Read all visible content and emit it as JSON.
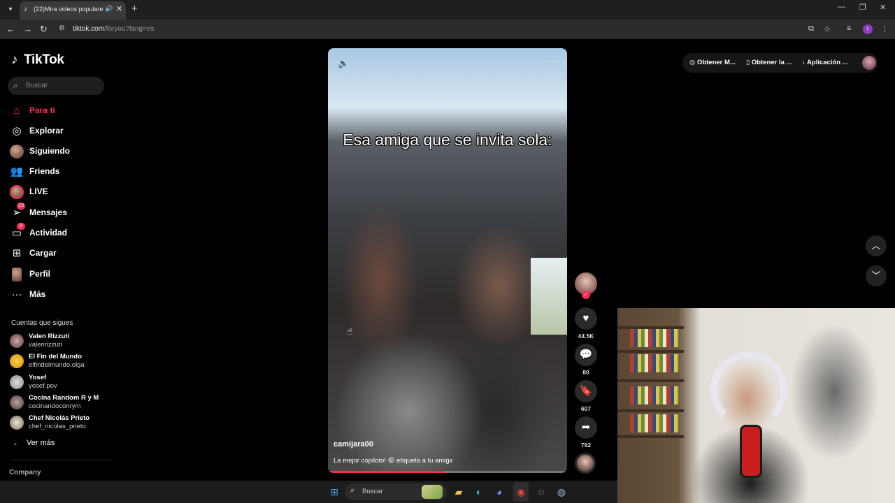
{
  "browser": {
    "tab_title": "(22)Mira videos populares",
    "tab_icon": "tiktok-icon",
    "url_host": "tiktok.com",
    "url_path": "/foryou?lang=es",
    "profile_initial": "I"
  },
  "tiktok": {
    "logo": "TikTok",
    "search_placeholder": "Buscar",
    "nav": [
      {
        "label": "Para ti",
        "icon": "home-icon",
        "active": true
      },
      {
        "label": "Explorar",
        "icon": "compass-icon"
      },
      {
        "label": "Siguiendo",
        "icon": "avatar-icon"
      },
      {
        "label": "Friends",
        "icon": "friends-icon"
      },
      {
        "label": "LIVE",
        "icon": "live-icon"
      },
      {
        "label": "Mensajes",
        "icon": "message-icon",
        "badge": "13"
      },
      {
        "label": "Actividad",
        "icon": "activity-icon",
        "badge": "9"
      },
      {
        "label": "Cargar",
        "icon": "upload-icon"
      },
      {
        "label": "Perfil",
        "icon": "profile-icon"
      },
      {
        "label": "Más",
        "icon": "more-icon"
      }
    ],
    "following_title": "Cuentas que sigues",
    "following": [
      {
        "name": "Valen Rizzuti",
        "user": "valenrizzuti"
      },
      {
        "name": "El Fin del Mundo",
        "user": "elfindelmundo.olga"
      },
      {
        "name": "Yosef",
        "user": "yosef.pov"
      },
      {
        "name": "Cocina Random R y M",
        "user": "cocinandoconrym"
      },
      {
        "name": "Chef Nicolás Prieto",
        "user": "chef_nicolas_prieto"
      }
    ],
    "see_more": "Ver más",
    "company": "Company",
    "top_buttons": [
      "Obtener M...",
      "Obtener la ...",
      "Aplicación ..."
    ],
    "video": {
      "caption": "Esa amiga que se invita sola:",
      "author": "camijara00",
      "description": "La mejor copiloto! 😝 etiqueta a tu amigx",
      "progress": 0.49,
      "likes": "44.5K",
      "comments": "80",
      "saves": "607",
      "shares": "792"
    }
  },
  "taskbar": {
    "search_placeholder": "Buscar"
  }
}
